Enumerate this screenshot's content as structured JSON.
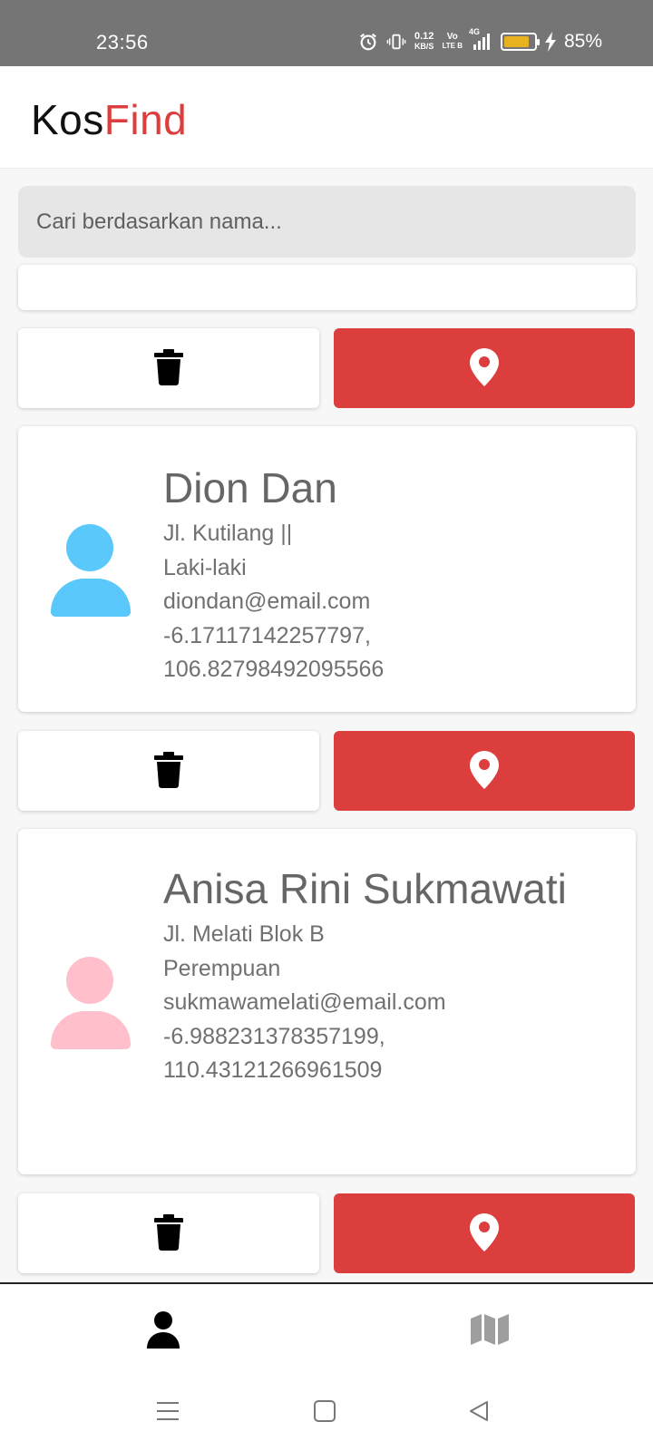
{
  "status_bar": {
    "time": "23:56",
    "net_speed_value": "0.12",
    "net_speed_unit": "KB/S",
    "volte_top": "Vo",
    "volte_bottom": "LTE B",
    "network": "4G",
    "battery_level_percent": 85,
    "battery_label": "85%",
    "battery_color": "#e7b21f"
  },
  "app": {
    "logo_kos": "Kos",
    "logo_find": "Find",
    "brand_color": "#dc3e3e"
  },
  "search": {
    "placeholder": "Cari berdasarkan nama..."
  },
  "users": [
    {
      "name": "Dion Dan",
      "address": "Jl. Kutilang ||",
      "gender": "Laki-laki",
      "email": "diondan@email.com",
      "latitude": "-6.17117142257797,",
      "longitude": "106.82798492095566",
      "avatar_color": "#5ac8fa"
    },
    {
      "name": "Anisa Rini Sukmawati",
      "address": "Jl. Melati Blok B",
      "gender": "Perempuan",
      "email": "sukmawamelati@email.com",
      "latitude": "-6.988231378357199,",
      "longitude": "110.43121266961509",
      "avatar_color": "#ffc0cb"
    }
  ],
  "actions": {
    "delete_icon": "trash-icon",
    "locate_icon": "map-marker-icon"
  },
  "bottom_nav": {
    "items": [
      {
        "icon": "user-icon",
        "active": true
      },
      {
        "icon": "map-icon",
        "active": false
      }
    ]
  },
  "system_nav": {
    "items": [
      "menu-icon",
      "home-square-icon",
      "back-triangle-icon"
    ]
  }
}
